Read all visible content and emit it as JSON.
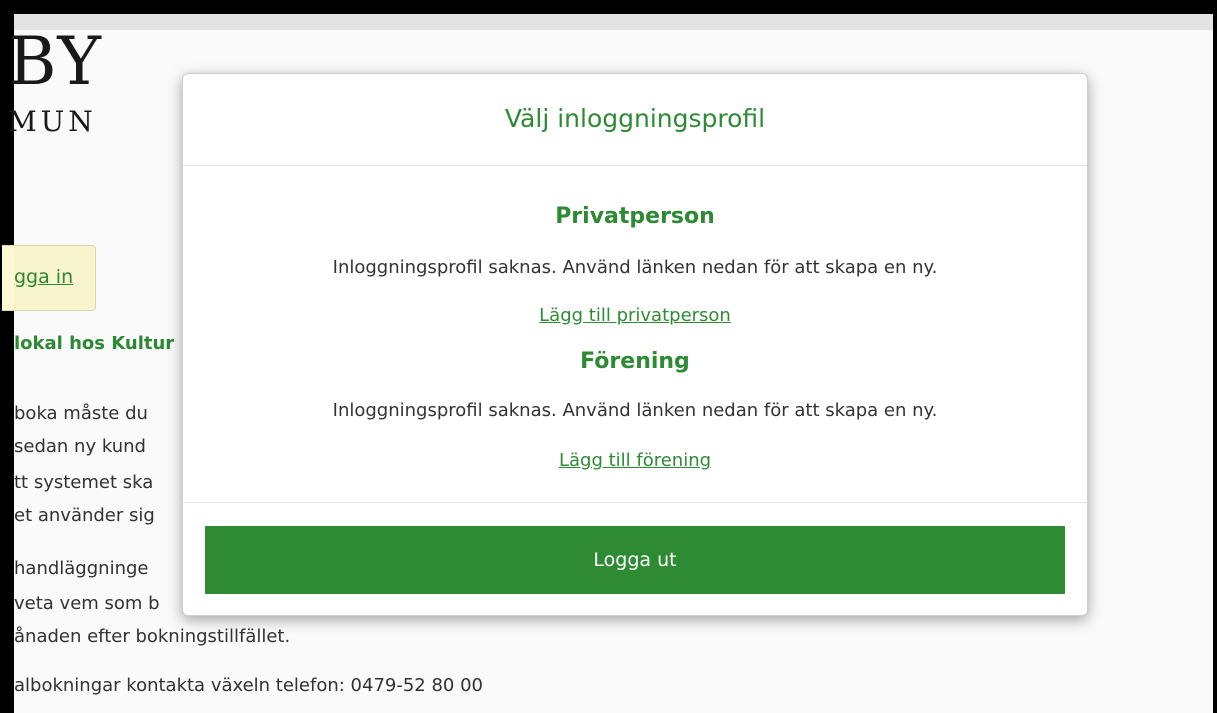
{
  "logo": {
    "line1": "BY",
    "line2": "MUN"
  },
  "background": {
    "login_label": "gga in",
    "heading": "lokal hos Kultur",
    "paragraph_lines": [
      "boka måste du",
      " sedan ny kund",
      "tt systemet ska",
      "et använder sig",
      " handläggninge",
      "veta vem som b",
      "ånaden efter bokningstillfället.",
      "albokningar kontakta växeln telefon: 0479-52 80 00"
    ]
  },
  "modal": {
    "title": "Välj inloggningsprofil",
    "sections": [
      {
        "title": "Privatperson",
        "text": "Inloggningsprofil saknas. Använd länken nedan för att skapa en ny.",
        "link": "Lägg till privatperson"
      },
      {
        "title": "Förening",
        "text": "Inloggningsprofil saknas. Använd länken nedan för att skapa en ny.",
        "link": "Lägg till förening"
      }
    ],
    "logout_label": "Logga ut"
  },
  "colors": {
    "accent": "#2e8b34",
    "login_bg": "#fdf9d3"
  }
}
